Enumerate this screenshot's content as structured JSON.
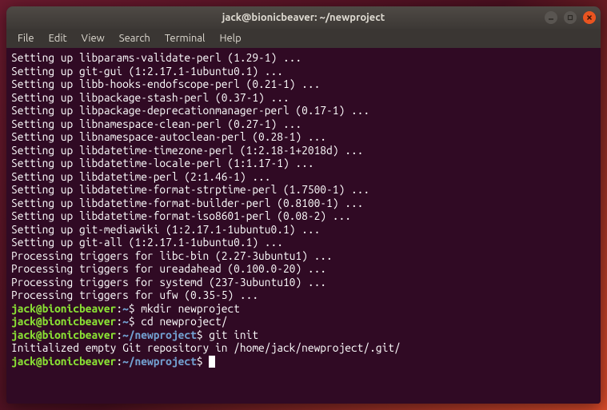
{
  "window": {
    "title": "jack@bionicbeaver: ~/newproject"
  },
  "menubar": {
    "items": [
      "File",
      "Edit",
      "View",
      "Search",
      "Terminal",
      "Help"
    ]
  },
  "terminal": {
    "output_lines": [
      "Setting up libparams-validate-perl (1.29-1) ...",
      "Setting up git-gui (1:2.17.1-1ubuntu0.1) ...",
      "Setting up libb-hooks-endofscope-perl (0.21-1) ...",
      "Setting up libpackage-stash-perl (0.37-1) ...",
      "Setting up libpackage-deprecationmanager-perl (0.17-1) ...",
      "Setting up libnamespace-clean-perl (0.27-1) ...",
      "Setting up libnamespace-autoclean-perl (0.28-1) ...",
      "Setting up libdatetime-timezone-perl (1:2.18-1+2018d) ...",
      "Setting up libdatetime-locale-perl (1:1.17-1) ...",
      "Setting up libdatetime-perl (2:1.46-1) ...",
      "Setting up libdatetime-format-strptime-perl (1.7500-1) ...",
      "Setting up libdatetime-format-builder-perl (0.8100-1) ...",
      "Setting up libdatetime-format-iso8601-perl (0.08-2) ...",
      "Setting up git-mediawiki (1:2.17.1-1ubuntu0.1) ...",
      "Setting up git-all (1:2.17.1-1ubuntu0.1) ...",
      "Processing triggers for libc-bin (2.27-3ubuntu1) ...",
      "Processing triggers for ureadahead (0.100.0-20) ...",
      "Processing triggers for systemd (237-3ubuntu10) ...",
      "Processing triggers for ufw (0.35-5) ..."
    ],
    "prompts": [
      {
        "user": "jack@bionicbeaver",
        "path": "~",
        "sym": "$",
        "cmd": "mkdir newproject"
      },
      {
        "user": "jack@bionicbeaver",
        "path": "~",
        "sym": "$",
        "cmd": "cd newproject/"
      },
      {
        "user": "jack@bionicbeaver",
        "path": "~/newproject",
        "sym": "$",
        "cmd": "git init"
      }
    ],
    "init_output": "Initialized empty Git repository in /home/jack/newproject/.git/",
    "final_prompt": {
      "user": "jack@bionicbeaver",
      "path": "~/newproject",
      "sym": "$",
      "cmd": ""
    }
  }
}
